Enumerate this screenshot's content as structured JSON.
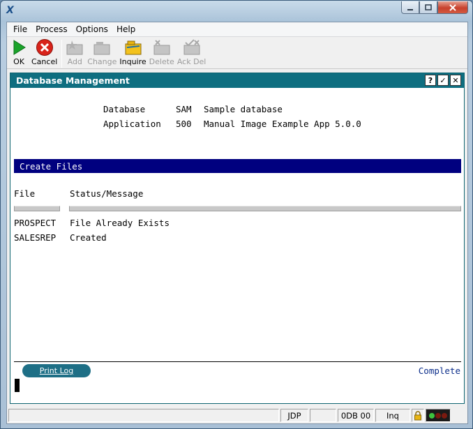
{
  "menu": [
    "File",
    "Process",
    "Options",
    "Help"
  ],
  "toolbar": {
    "ok": "OK",
    "cancel": "Cancel",
    "add": "Add",
    "change": "Change",
    "inquire": "Inquire",
    "delete": "Delete",
    "ack_del": "Ack Del"
  },
  "inner_window": {
    "title": "Database Management",
    "help_btn": "?",
    "check_btn": "✓",
    "close_btn": "✕"
  },
  "info": {
    "database_label": "Database",
    "database_code": "SAM",
    "database_desc": "Sample database",
    "application_label": "Application",
    "application_code": "500",
    "application_desc": "Manual Image Example App 5.0.0"
  },
  "section_title": "Create Files",
  "columns": {
    "file": "File",
    "status": "Status/Message"
  },
  "rows": [
    {
      "file": "PROSPECT",
      "status": "File Already Exists"
    },
    {
      "file": "SALESREP",
      "status": "Created"
    }
  ],
  "print_log": "Print Log",
  "completion_status": "Complete",
  "statusbar": {
    "user": "JDP",
    "db": "0DB 00",
    "mode": "Inq"
  },
  "colors": {
    "inner_title_bg": "#0e6e80",
    "section_bg": "#00007f",
    "print_btn_bg": "#1e6f86",
    "complete_text": "#0b2d8a"
  }
}
